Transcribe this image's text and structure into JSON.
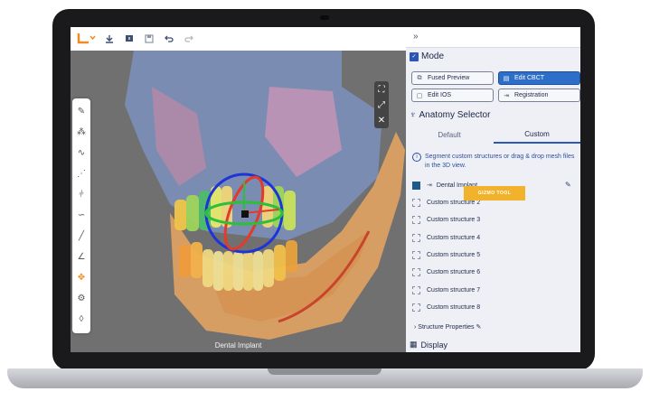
{
  "toolbar": {
    "logo_icon": "brand-logo-icon",
    "icons": [
      "download-icon",
      "export-icon",
      "save-icon",
      "undo-icon",
      "redo-icon"
    ]
  },
  "left_tools": [
    "pencil-icon",
    "magic-wand-icon",
    "spline-icon",
    "add-point-icon",
    "align-icon",
    "curve-icon",
    "ruler-icon",
    "angle-icon",
    "move-icon",
    "settings-icon",
    "drop-icon"
  ],
  "view": {
    "caption": "Dental Implant",
    "controls": [
      "fullscreen-icon",
      "expand-icon",
      "close-icon"
    ]
  },
  "panel": {
    "collapse_icon": "»",
    "mode": {
      "title": "Mode",
      "buttons": [
        {
          "label": "Fused Preview",
          "active": false
        },
        {
          "label": "Edit CBCT",
          "active": true
        },
        {
          "label": "Edit IOS",
          "active": false
        },
        {
          "label": "Registration",
          "active": false
        }
      ]
    },
    "anatomy": {
      "title": "Anatomy Selector",
      "tabs": [
        {
          "label": "Default",
          "selected": false
        },
        {
          "label": "Custom",
          "selected": true
        }
      ],
      "info": "Segment custom structures or drag & drop mesh files in the 3D view.",
      "structures": [
        {
          "label": "Dental Implant",
          "checked": true
        },
        {
          "label": "Custom structure 2",
          "checked": false
        },
        {
          "label": "Custom structure 3",
          "checked": false
        },
        {
          "label": "Custom structure 4",
          "checked": false
        },
        {
          "label": "Custom structure 5",
          "checked": false
        },
        {
          "label": "Custom structure 6",
          "checked": false
        },
        {
          "label": "Custom structure 7",
          "checked": false
        },
        {
          "label": "Custom structure 8",
          "checked": false
        }
      ],
      "properties": "Structure Properties"
    },
    "display": {
      "title": "Display"
    }
  },
  "tooltip": {
    "label": "GIZMO TOOL"
  },
  "colors": {
    "accent": "#2d6ec9",
    "tooltip": "#f0b32b",
    "brand": "#f28b1d"
  }
}
